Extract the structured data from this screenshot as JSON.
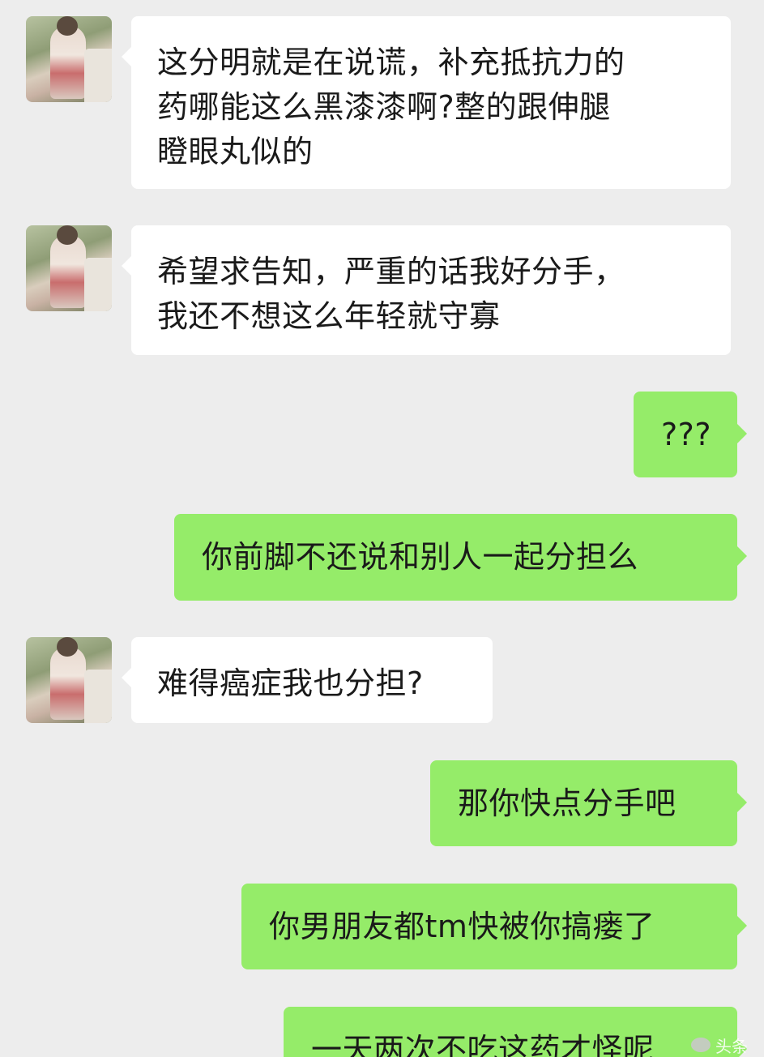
{
  "messages": [
    {
      "side": "in",
      "text": "这分明就是在说谎，补充抵抗力的\n药哪能这么黑漆漆啊?整的跟伸腿\n瞪眼丸似的"
    },
    {
      "side": "in",
      "text": "希望求告知，严重的话我好分手，\n我还不想这么年轻就守寡"
    },
    {
      "side": "out",
      "text": "???"
    },
    {
      "side": "out",
      "text": "你前脚不还说和别人一起分担么"
    },
    {
      "side": "in",
      "text": "难得癌症我也分担?"
    },
    {
      "side": "out",
      "text": "那你快点分手吧"
    },
    {
      "side": "out",
      "text": "你男朋友都tm快被你搞瘘了"
    },
    {
      "side": "out",
      "text": "一天两次不吃这药才怪呢"
    }
  ],
  "watermark": {
    "icon": "wechat-icon",
    "text": "头条"
  },
  "colors": {
    "background": "#ededed",
    "incoming_bubble": "#ffffff",
    "outgoing_bubble": "#95ec69"
  }
}
